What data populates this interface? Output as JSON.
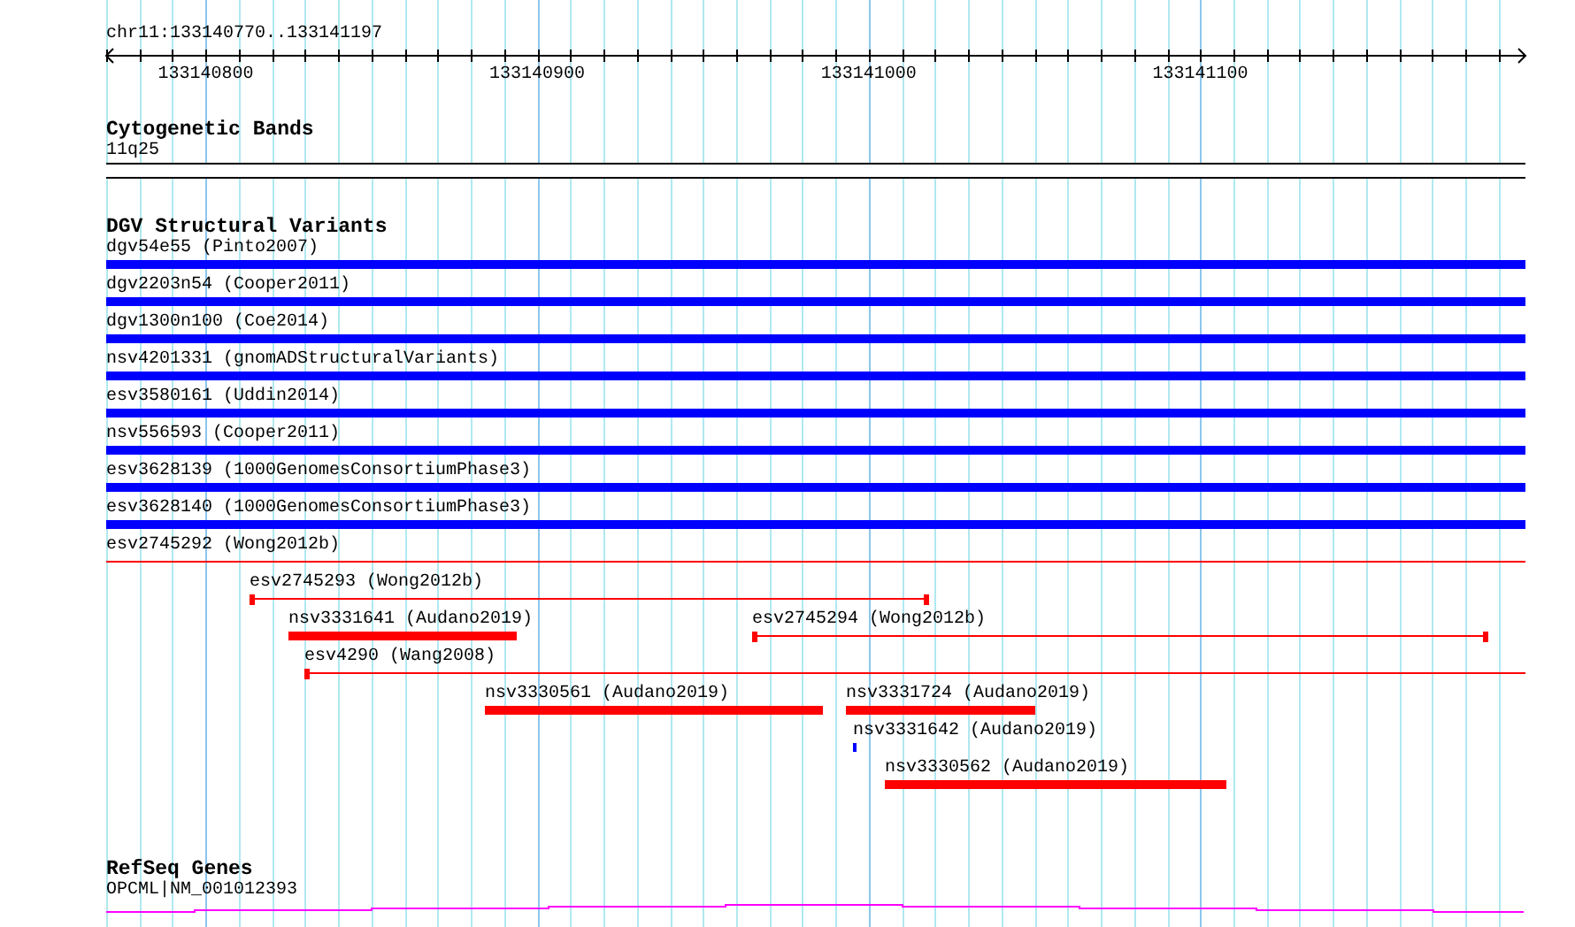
{
  "ruler": {
    "location": "chr11:133140770..133141197",
    "tick_labels": [
      "133140800",
      "133140900",
      "133141000",
      "133141100"
    ]
  },
  "tracks": [
    {
      "kind": "cytoband",
      "title": "Cytogenetic Bands",
      "band": {
        "label": "11q25"
      }
    },
    {
      "kind": "variants",
      "title": "DGV Structural Variants",
      "rows": [
        {
          "features": [
            {
              "kind": "box",
              "label": "dgv54e55 (Pinto2007)",
              "color": "#0000ff"
            }
          ]
        },
        {
          "features": [
            {
              "kind": "box",
              "label": "dgv2203n54 (Cooper2011)",
              "color": "#0000ff"
            }
          ]
        },
        {
          "features": [
            {
              "kind": "box",
              "label": "dgv1300n100 (Coe2014)",
              "color": "#0000ff"
            }
          ]
        },
        {
          "features": [
            {
              "kind": "box",
              "label": "nsv4201331 (gnomADStructuralVariants)",
              "color": "#0000ff"
            }
          ]
        },
        {
          "features": [
            {
              "kind": "box",
              "label": "esv3580161 (Uddin2014)",
              "color": "#0000ff"
            }
          ]
        },
        {
          "features": [
            {
              "kind": "box",
              "label": "nsv556593 (Cooper2011)",
              "color": "#0000ff"
            }
          ]
        },
        {
          "features": [
            {
              "kind": "box",
              "label": "esv3628139 (1000GenomesConsortiumPhase3)",
              "color": "#0000ff"
            }
          ]
        },
        {
          "features": [
            {
              "kind": "box",
              "label": "esv3628140 (1000GenomesConsortiumPhase3)",
              "color": "#0000ff"
            }
          ]
        },
        {
          "features": [
            {
              "kind": "span",
              "label": "esv2745292 (Wong2012b)",
              "color": "#ff0000"
            }
          ]
        },
        {
          "features": [
            {
              "kind": "span",
              "label": "esv2745293 (Wong2012b)",
              "color": "#ff0000"
            }
          ]
        },
        {
          "features": [
            {
              "kind": "box",
              "label": "nsv3331641 (Audano2019)",
              "color": "#ff0000"
            },
            {
              "kind": "span",
              "label": "esv2745294 (Wong2012b)",
              "color": "#ff0000"
            }
          ]
        },
        {
          "features": [
            {
              "kind": "span",
              "label": "esv4290 (Wang2008)",
              "color": "#ff0000"
            }
          ]
        },
        {
          "features": [
            {
              "kind": "box",
              "label": "nsv3330561 (Audano2019)",
              "color": "#ff0000"
            },
            {
              "kind": "box",
              "label": "nsv3331724 (Audano2019)",
              "color": "#ff0000"
            }
          ]
        },
        {
          "features": [
            {
              "kind": "box",
              "label": "nsv3331642 (Audano2019)",
              "color": "#0000ff"
            }
          ]
        },
        {
          "features": [
            {
              "kind": "box",
              "label": "nsv3330562 (Audano2019)",
              "color": "#ff0000"
            }
          ]
        }
      ]
    },
    {
      "kind": "genes",
      "title": "RefSeq Genes",
      "gene": {
        "label": "OPCML|NM_001012393",
        "color": "#ff00ff"
      }
    }
  ]
}
